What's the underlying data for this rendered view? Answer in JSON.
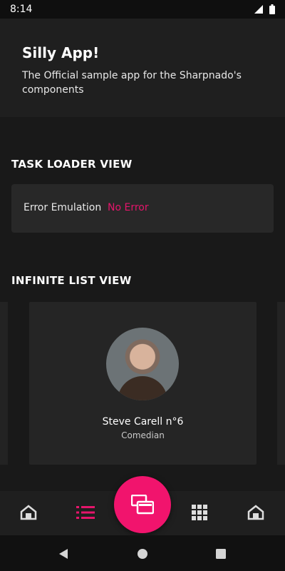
{
  "status_bar": {
    "time": "8:14"
  },
  "header": {
    "title": "Silly App!",
    "subtitle": "The Official sample app for the Sharpnado's components"
  },
  "task_loader": {
    "section_title": "TASK LOADER VIEW",
    "label": "Error Emulation",
    "value": "No Error"
  },
  "infinite_list": {
    "section_title": "INFINITE LIST VIEW",
    "card": {
      "name": "Steve Carell n°6",
      "role": "Comedian"
    }
  },
  "tabs": [
    {
      "icon": "home-icon",
      "selected": false
    },
    {
      "icon": "list-icon",
      "selected": true
    },
    {
      "icon": "grid-icon",
      "selected": false
    },
    {
      "icon": "home-icon",
      "selected": false
    }
  ],
  "fab": {
    "icon": "copy-windows-icon"
  },
  "colors": {
    "accent": "#e5156b",
    "fab": "#f1146d",
    "background": "#191919"
  }
}
